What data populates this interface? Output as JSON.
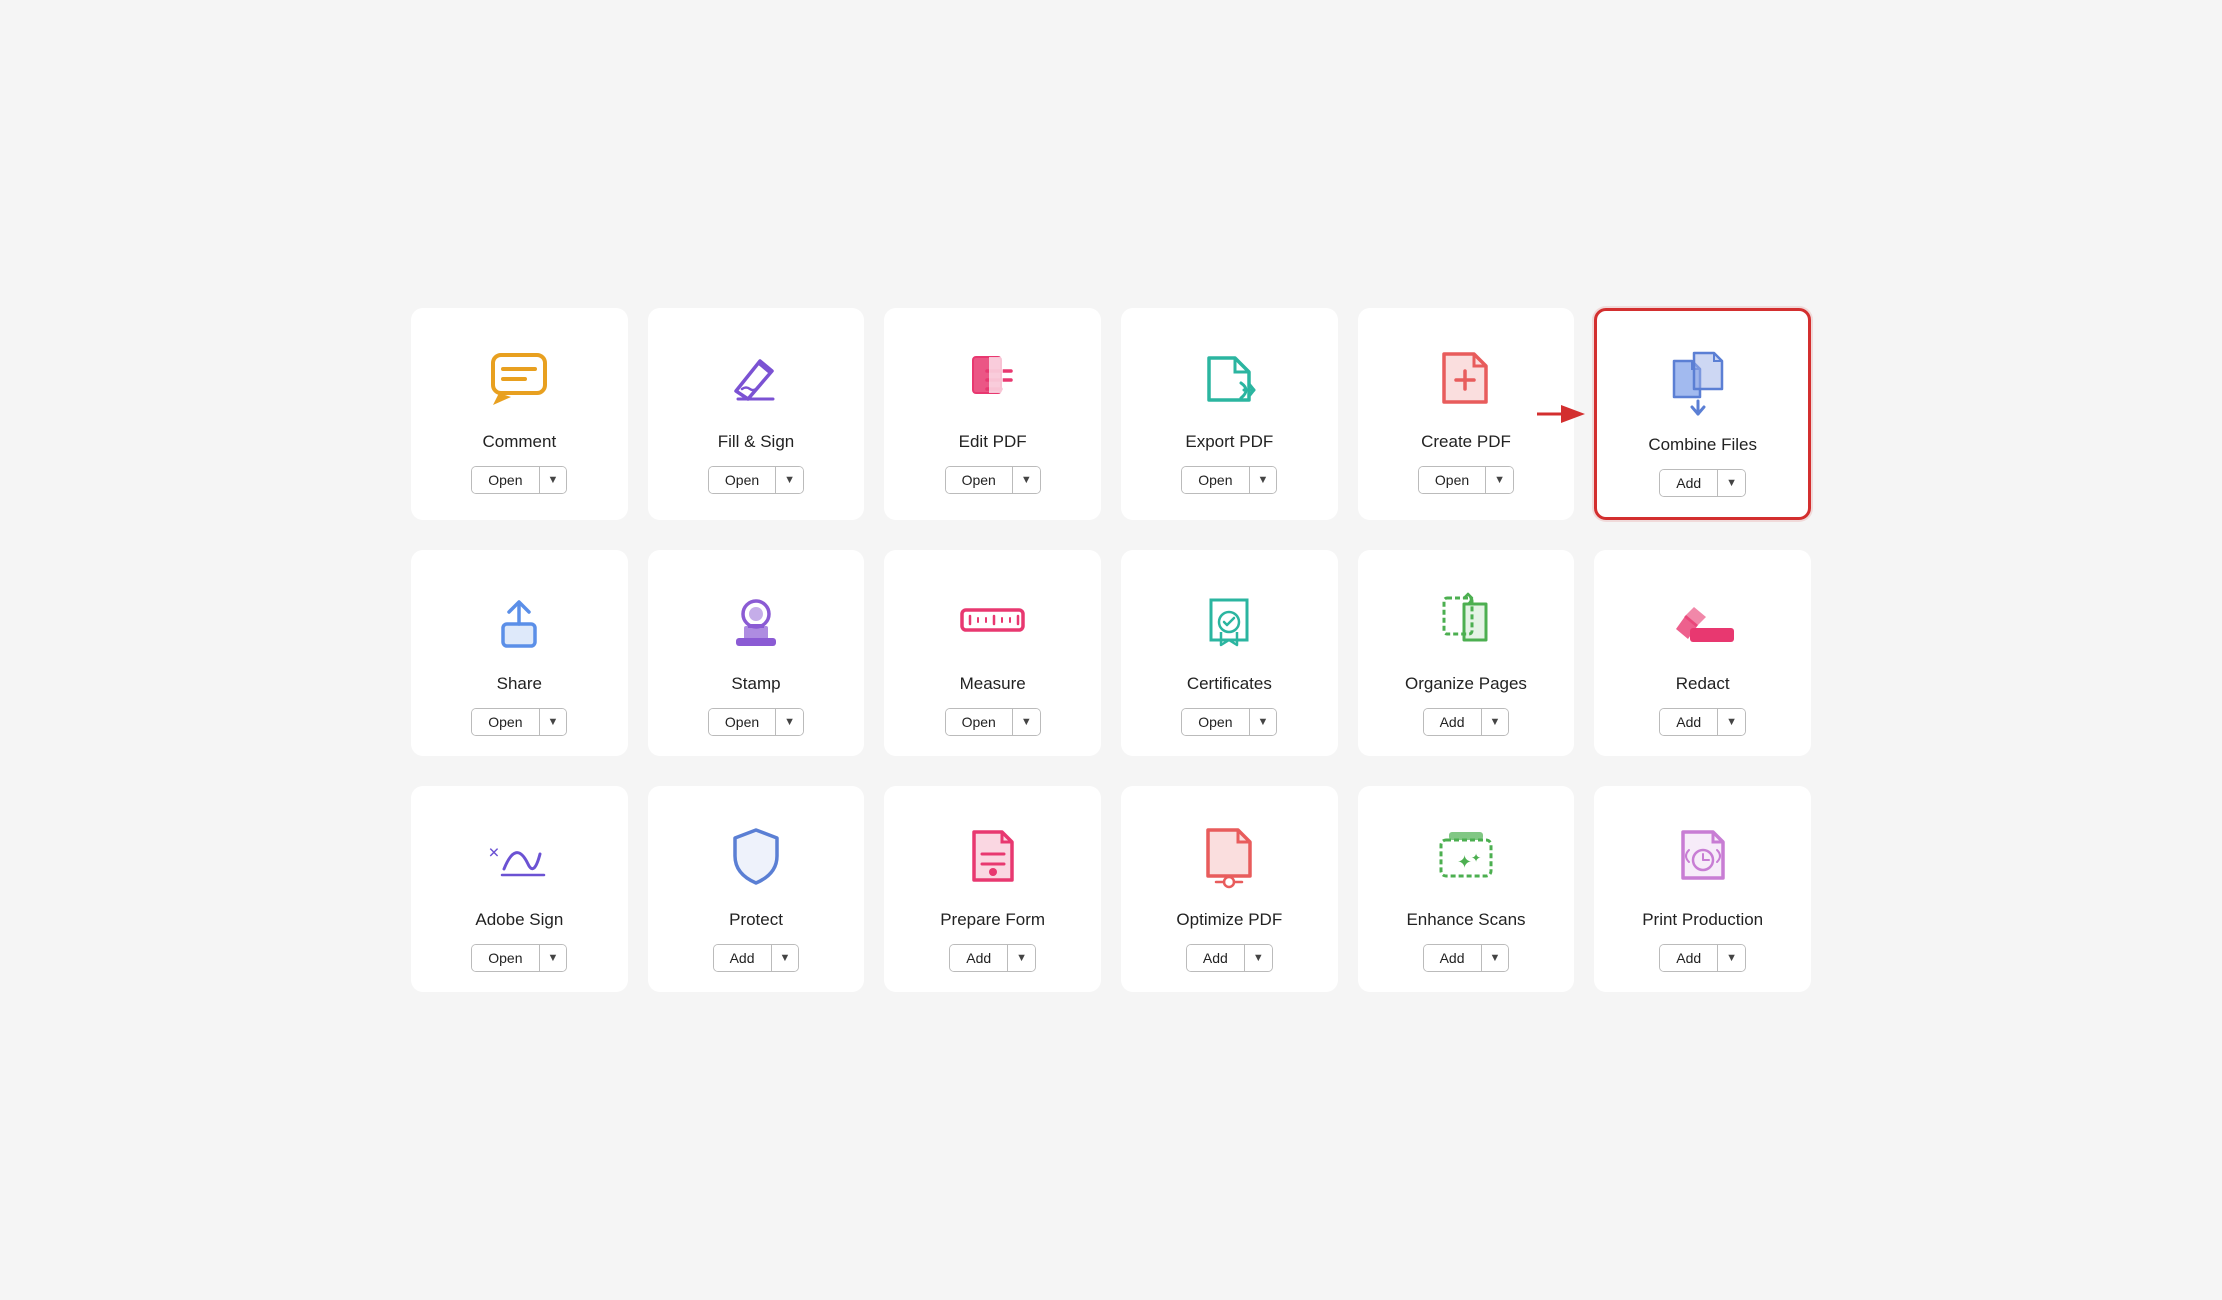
{
  "tools": [
    {
      "id": "comment",
      "label": "Comment",
      "button": "Open",
      "highlighted": false,
      "has_arrow": false,
      "icon_color": "#E8A020",
      "icon_type": "comment"
    },
    {
      "id": "fill-sign",
      "label": "Fill & Sign",
      "button": "Open",
      "highlighted": false,
      "has_arrow": false,
      "icon_color": "#7B52D3",
      "icon_type": "fill-sign"
    },
    {
      "id": "edit-pdf",
      "label": "Edit PDF",
      "button": "Open",
      "highlighted": false,
      "has_arrow": false,
      "icon_color": "#E83870",
      "icon_type": "edit-pdf"
    },
    {
      "id": "export-pdf",
      "label": "Export PDF",
      "button": "Open",
      "highlighted": false,
      "has_arrow": false,
      "icon_color": "#2BB5A0",
      "icon_type": "export-pdf"
    },
    {
      "id": "create-pdf",
      "label": "Create PDF",
      "button": "Open",
      "highlighted": false,
      "has_arrow": false,
      "icon_color": "#E85C5C",
      "icon_type": "create-pdf"
    },
    {
      "id": "combine-files",
      "label": "Combine Files",
      "button": "Add",
      "highlighted": true,
      "has_arrow": true,
      "icon_color": "#5B7FD4",
      "icon_type": "combine-files"
    },
    {
      "id": "share",
      "label": "Share",
      "button": "Open",
      "highlighted": false,
      "has_arrow": false,
      "icon_color": "#5B8FE8",
      "icon_type": "share"
    },
    {
      "id": "stamp",
      "label": "Stamp",
      "button": "Open",
      "highlighted": false,
      "has_arrow": false,
      "icon_color": "#8B5BD4",
      "icon_type": "stamp"
    },
    {
      "id": "measure",
      "label": "Measure",
      "button": "Open",
      "highlighted": false,
      "has_arrow": false,
      "icon_color": "#E83870",
      "icon_type": "measure"
    },
    {
      "id": "certificates",
      "label": "Certificates",
      "button": "Open",
      "highlighted": false,
      "has_arrow": false,
      "icon_color": "#2BB5A0",
      "icon_type": "certificates"
    },
    {
      "id": "organize-pages",
      "label": "Organize Pages",
      "button": "Add",
      "highlighted": false,
      "has_arrow": false,
      "icon_color": "#4CAF50",
      "icon_type": "organize-pages"
    },
    {
      "id": "redact",
      "label": "Redact",
      "button": "Add",
      "highlighted": false,
      "has_arrow": false,
      "icon_color": "#E83870",
      "icon_type": "redact"
    },
    {
      "id": "adobe-sign",
      "label": "Adobe Sign",
      "button": "Open",
      "highlighted": false,
      "has_arrow": false,
      "icon_color": "#6B52D3",
      "icon_type": "adobe-sign"
    },
    {
      "id": "protect",
      "label": "Protect",
      "button": "Add",
      "highlighted": false,
      "has_arrow": false,
      "icon_color": "#5B7FD4",
      "icon_type": "protect"
    },
    {
      "id": "prepare-form",
      "label": "Prepare Form",
      "button": "Add",
      "highlighted": false,
      "has_arrow": false,
      "icon_color": "#E83870",
      "icon_type": "prepare-form"
    },
    {
      "id": "optimize-pdf",
      "label": "Optimize PDF",
      "button": "Add",
      "highlighted": false,
      "has_arrow": false,
      "icon_color": "#E85C5C",
      "icon_type": "optimize-pdf"
    },
    {
      "id": "enhance-scans",
      "label": "Enhance Scans",
      "button": "Add",
      "highlighted": false,
      "has_arrow": false,
      "icon_color": "#4CAF50",
      "icon_type": "enhance-scans"
    },
    {
      "id": "print-production",
      "label": "Print Production",
      "button": "Add",
      "highlighted": false,
      "has_arrow": false,
      "icon_color": "#C87DD4",
      "icon_type": "print-production"
    }
  ]
}
